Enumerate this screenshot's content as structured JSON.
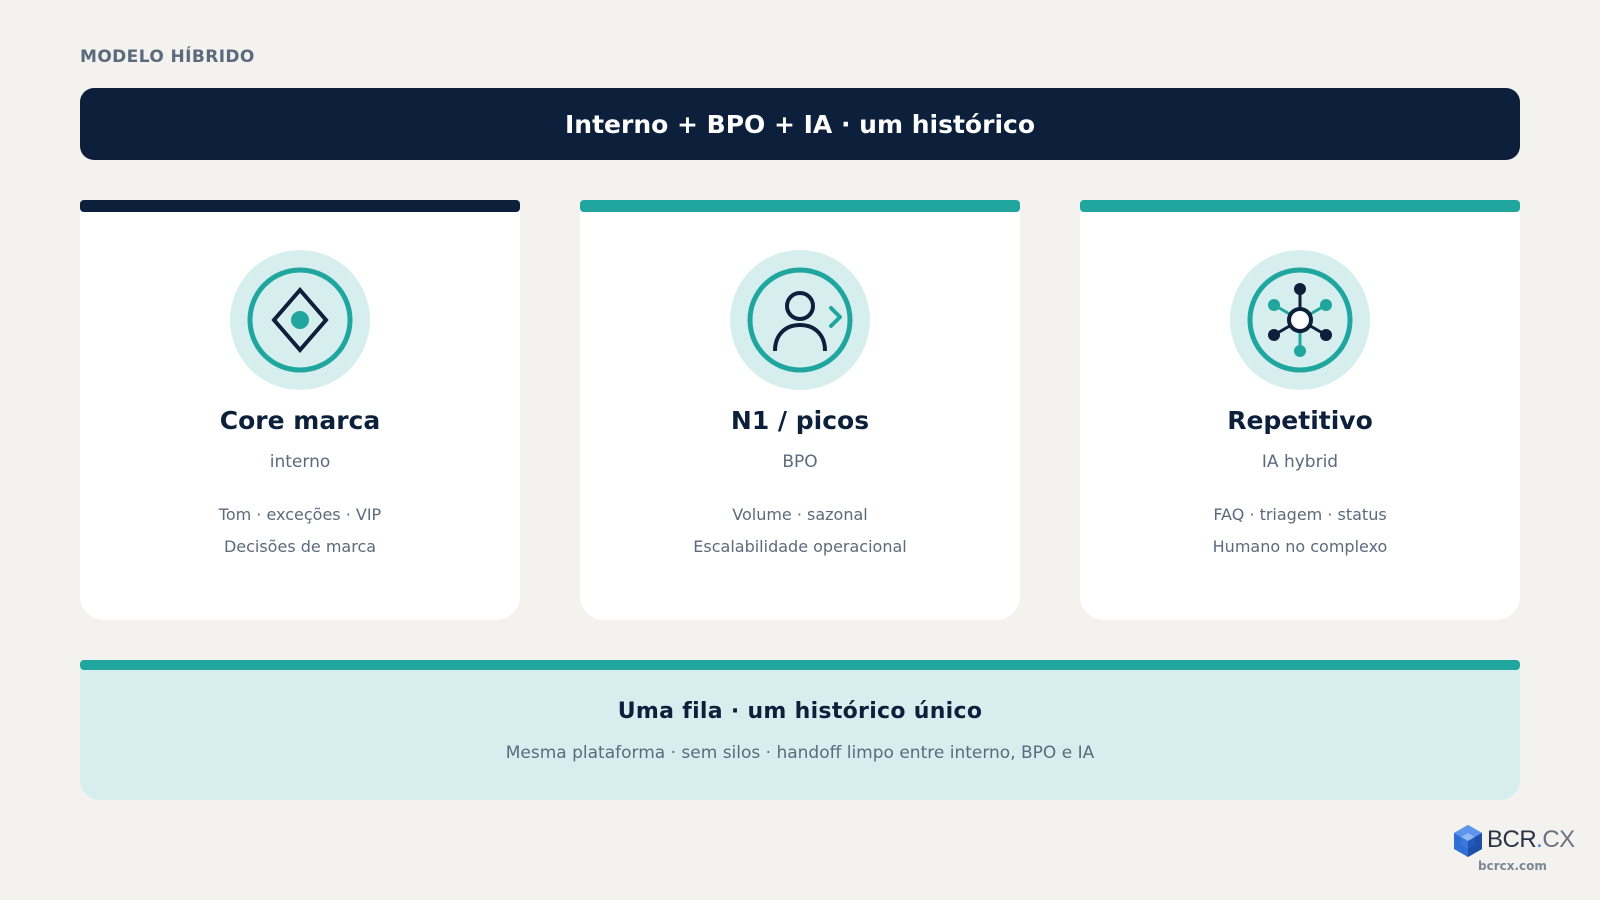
{
  "eyebrow": "MODELO HÍBRIDO",
  "banner": {
    "title": "Interno + BPO + IA · um histórico"
  },
  "colors": {
    "navy": "#0c1f3b",
    "teal": "#20a69f",
    "teal_light": "#d6efee",
    "muted_text": "#5b6a7c",
    "background": "#f3f2ef"
  },
  "cards": [
    {
      "icon": "diamond-target-icon",
      "accent": "#0c1f3b",
      "title": "Core marca",
      "subtitle": "interno",
      "lines": [
        "Tom · exceções · VIP",
        "Decisões de marca"
      ]
    },
    {
      "icon": "user-forward-icon",
      "accent": "#20a69f",
      "title": "N1 / picos",
      "subtitle": "BPO",
      "lines": [
        "Volume · sazonal",
        "Escalabilidade operacional"
      ]
    },
    {
      "icon": "network-hub-icon",
      "accent": "#20a69f",
      "title": "Repetitivo",
      "subtitle": "IA hybrid",
      "lines": [
        "FAQ · triagem · status",
        "Humano no complexo"
      ]
    }
  ],
  "footer": {
    "title": "Uma fila · um histórico único",
    "subtitle": "Mesma plataforma · sem silos · handoff limpo entre interno, BPO e IA"
  },
  "brand": {
    "name_main": "BCR",
    "name_dot": ".",
    "name_suffix": "CX",
    "url": "bcrcx.com",
    "logo_icon": "cube-logo-icon"
  }
}
